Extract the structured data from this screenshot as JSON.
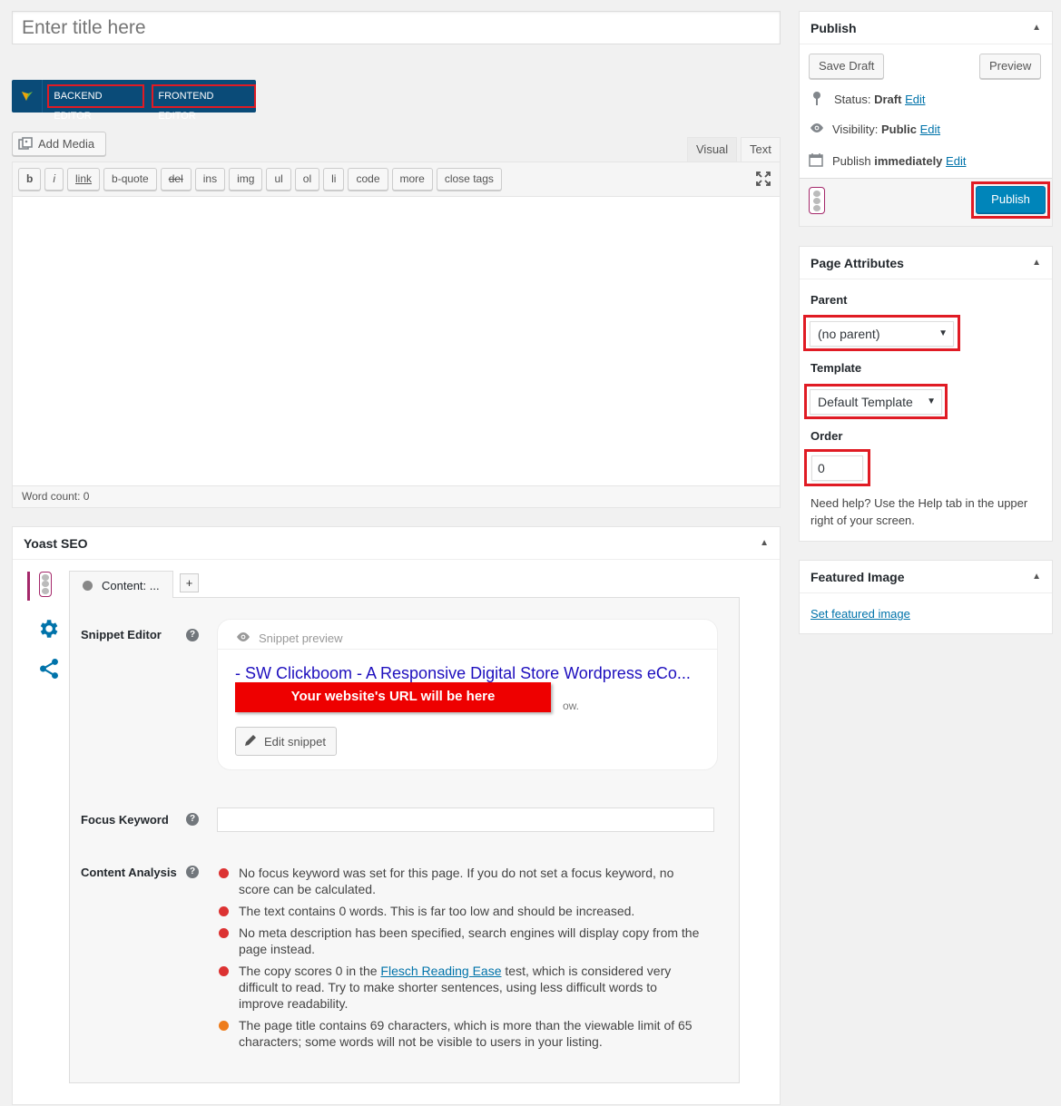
{
  "title_field": {
    "placeholder": "Enter title here"
  },
  "vc": {
    "backend_label": "BACKEND EDITOR",
    "frontend_label": "FRONTEND EDITOR"
  },
  "editor": {
    "add_media_label": "Add Media",
    "tabs": [
      "Visual",
      "Text"
    ],
    "active_tab": "Text",
    "quicktags": [
      "b",
      "i",
      "link",
      "b-quote",
      "del",
      "ins",
      "img",
      "ul",
      "ol",
      "li",
      "code",
      "more",
      "close tags"
    ],
    "word_count": "Word count: 0"
  },
  "yoast": {
    "title": "Yoast SEO",
    "tab_label": "Content: ...",
    "plus_label": "+",
    "snippet_editor_label": "Snippet Editor",
    "snippet_preview_label": "Snippet preview",
    "snippet_title": "- SW Clickboom - A Responsive Digital Store Wordpress eCo...",
    "snippet_url_banner": "Your website's URL will be here",
    "snippet_desc_tail": "ow.",
    "edit_snippet_label": "Edit snippet",
    "focus_keyword_label": "Focus Keyword",
    "content_analysis_label": "Content Analysis",
    "analysis": [
      {
        "color": "#dc3232",
        "text": "No focus keyword was set for this page. If you do not set a focus keyword, no score can be calculated."
      },
      {
        "color": "#dc3232",
        "text": "The text contains 0 words. This is far too low and should be increased."
      },
      {
        "color": "#dc3232",
        "text": "No meta description has been specified, search engines will display copy from the page instead."
      },
      {
        "color": "#dc3232",
        "text_before": "The copy scores 0 in the ",
        "link": "Flesch Reading Ease",
        "text_after": " test, which is considered very difficult to read. Try to make shorter sentences, using less difficult words to improve readability."
      },
      {
        "color": "#ee7c1b",
        "text": "The page title contains 69 characters, which is more than the viewable limit of 65 characters; some words will not be visible to users in your listing."
      }
    ]
  },
  "publish": {
    "title": "Publish",
    "save_draft": "Save Draft",
    "preview": "Preview",
    "status_label": "Status:",
    "status_value": "Draft",
    "visibility_label": "Visibility:",
    "visibility_value": "Public",
    "publish_label": "Publish",
    "publish_value": "immediately",
    "edit_link": "Edit",
    "publish_button": "Publish"
  },
  "page_attributes": {
    "title": "Page Attributes",
    "parent_label": "Parent",
    "parent_value": "(no parent)",
    "template_label": "Template",
    "template_value": "Default Template",
    "order_label": "Order",
    "order_value": "0",
    "help_text": "Need help? Use the Help tab in the upper right of your screen."
  },
  "featured_image": {
    "title": "Featured Image",
    "link": "Set featured image"
  },
  "colors": {
    "accent": "#0073aa",
    "primary_button": "#0085ba",
    "highlight": "#e01b24",
    "vc_bar": "#0a4b78",
    "yoast_purple": "#a4286a"
  }
}
